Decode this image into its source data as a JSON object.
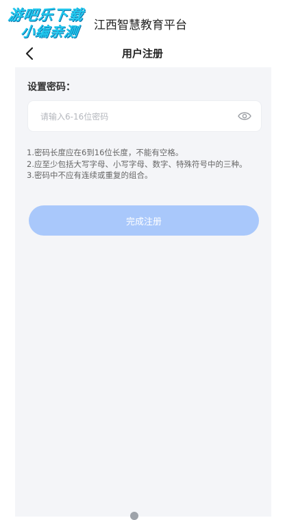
{
  "watermark": {
    "line1": "游吧乐下载",
    "line2": "小编亲测"
  },
  "app": {
    "title": "江西智慧教育平台"
  },
  "nav": {
    "title": "用户注册",
    "back_icon": "chevron-left-icon"
  },
  "form": {
    "label": "设置密码：",
    "password_placeholder": "请输入6-16位密码",
    "eye_icon": "eye-icon"
  },
  "rules": [
    "1.密码长度应在6到16位长度，不能有空格。",
    "2.应至少包括大写字母、小写字母、数字、特殊符号中的三种。",
    "3.密码中不应有连续或重复的组合。"
  ],
  "submit_label": "完成注册",
  "colors": {
    "accent_disabled": "#a9c8fb",
    "panel_bg": "#f4f5f8",
    "watermark": "#22c8ee"
  }
}
